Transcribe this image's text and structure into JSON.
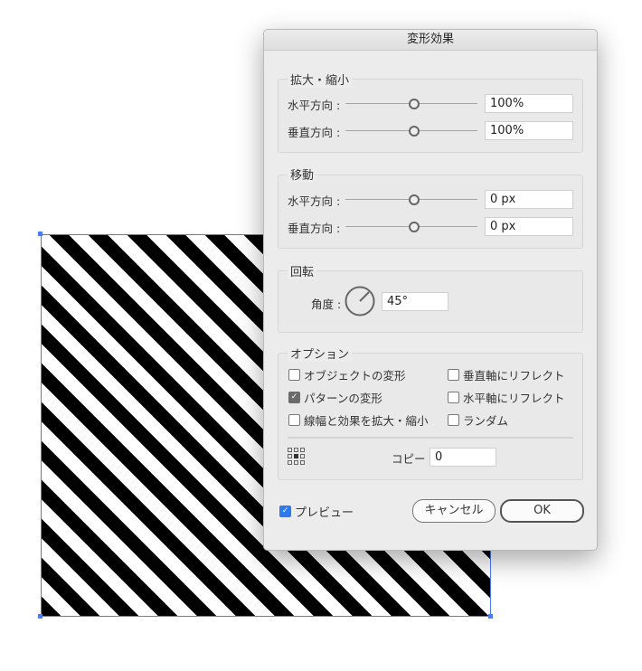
{
  "dialog": {
    "title": "変形効果",
    "scale": {
      "label": "拡大・縮小",
      "horizontal_label": "水平方向 :",
      "horizontal_value": "100%",
      "vertical_label": "垂直方向 :",
      "vertical_value": "100%"
    },
    "move": {
      "label": "移動",
      "horizontal_label": "水平方向 :",
      "horizontal_value": "0 px",
      "vertical_label": "垂直方向 :",
      "vertical_value": "0 px"
    },
    "rotate": {
      "label": "回転",
      "angle_label": "角度 :",
      "angle_value": "45°"
    },
    "options": {
      "label": "オプション",
      "transform_objects": {
        "label": "オブジェクトの変形",
        "checked": false
      },
      "transform_patterns": {
        "label": "パターンの変形",
        "checked": true
      },
      "scale_strokes": {
        "label": "線幅と効果を拡大・縮小",
        "checked": false
      },
      "reflect_x": {
        "label": "垂直軸にリフレクト",
        "checked": false
      },
      "reflect_y": {
        "label": "水平軸にリフレクト",
        "checked": false
      },
      "random": {
        "label": "ランダム",
        "checked": false
      },
      "copies_label": "コピー",
      "copies_value": "0"
    },
    "preview": {
      "label": "プレビュー",
      "checked": true
    },
    "cancel_label": "キャンセル",
    "ok_label": "OK"
  }
}
